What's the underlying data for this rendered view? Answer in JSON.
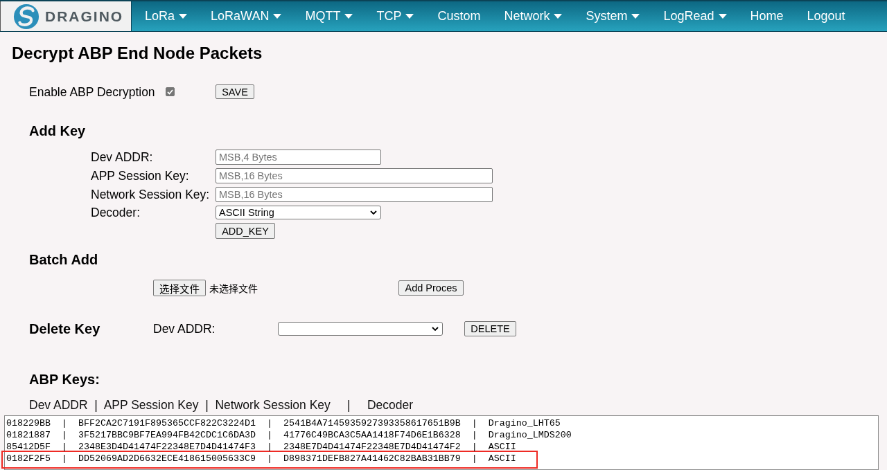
{
  "header": {
    "logo_text": "DRAGINO",
    "nav": [
      {
        "label": "LoRa",
        "has_menu": true
      },
      {
        "label": "LoRaWAN",
        "has_menu": true
      },
      {
        "label": "MQTT",
        "has_menu": true
      },
      {
        "label": "TCP",
        "has_menu": true
      },
      {
        "label": "Custom",
        "has_menu": false
      },
      {
        "label": "Network",
        "has_menu": true
      },
      {
        "label": "System",
        "has_menu": true
      },
      {
        "label": "LogRead",
        "has_menu": true
      },
      {
        "label": "Home",
        "has_menu": false
      },
      {
        "label": "Logout",
        "has_menu": false
      }
    ]
  },
  "page_title": "Decrypt ABP End Node Packets",
  "enable": {
    "label": "Enable ABP Decryption",
    "checked": true,
    "button": "SAVE"
  },
  "add_key": {
    "title": "Add Key",
    "fields": [
      {
        "kind": "address",
        "label": "Dev ADDR:",
        "placeholder": "MSB,4 Bytes"
      },
      {
        "kind": "key",
        "label": "APP Session Key:",
        "placeholder": "MSB,16 Bytes"
      },
      {
        "kind": "key",
        "label": "Network Session Key:",
        "placeholder": "MSB,16 Bytes"
      },
      {
        "kind": "select",
        "label": "Decoder:",
        "value": "ASCII String"
      }
    ],
    "button": "ADD_KEY"
  },
  "batch_add": {
    "title": "Batch Add",
    "file_button": "选择文件",
    "file_status": "未选择文件",
    "button": "Add Proces"
  },
  "delete_key": {
    "title": "Delete Key",
    "label": "Dev ADDR:",
    "button": "DELETE"
  },
  "abp_keys": {
    "title": "ABP Keys:",
    "columns": "Dev ADDR  |  APP Session Key  |  Network Session Key     |     Decoder",
    "lines": [
      {
        "text": "018229BB  |  BFF2CA2C7191F895365CCF822C3224D1  |  2541B4A7145935927393358617651B9B  |  Dragino_LHT65",
        "highlighted": false
      },
      {
        "text": "01821887  |  3F5217BBC9BF7EA994FB42CDC1C6DA3D  |  41776C49BCA3C5AA1418F74D6E1B6328  |  Dragino_LMDS200",
        "highlighted": false
      },
      {
        "text": "85412D5F  |  2348E3D4D41474F22348E7D4D41474F3  |  2348E7D4D41474F22348E7D4D41474F2  |  ASCII",
        "highlighted": false
      },
      {
        "text": "0182F2F5  |  DD52069AD2D6632ECE418615005633C9  |  D898371DEFB827A41462C82BAB31BB79  |  ASCII",
        "highlighted": true
      }
    ]
  }
}
